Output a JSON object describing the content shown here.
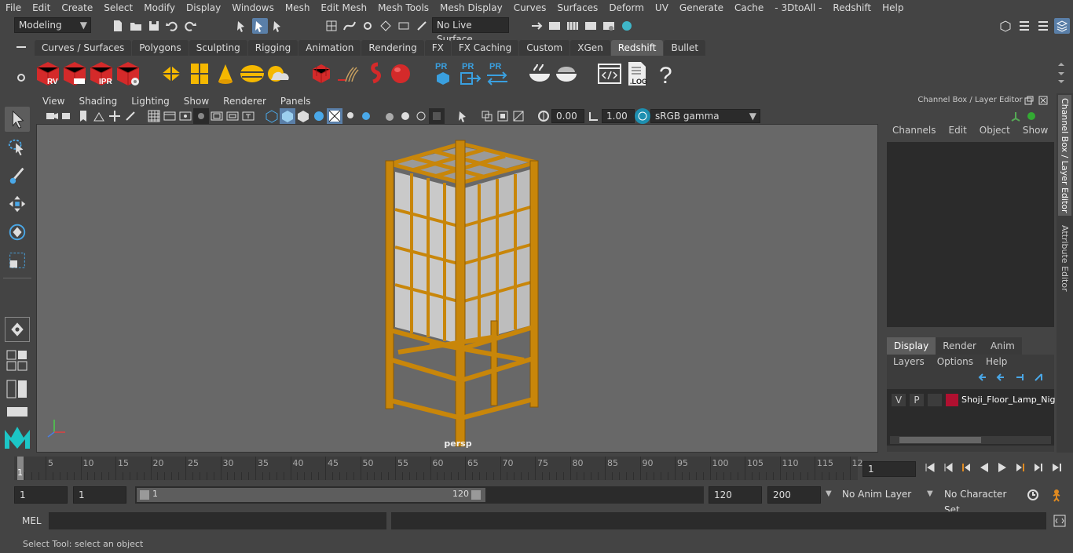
{
  "menubar": {
    "items": [
      "File",
      "Edit",
      "Create",
      "Select",
      "Modify",
      "Display",
      "Windows",
      "Mesh",
      "Edit Mesh",
      "Mesh Tools",
      "Mesh Display",
      "Curves",
      "Surfaces",
      "Deform",
      "UV",
      "Generate",
      "Cache",
      "- 3DtoAll -",
      "Redshift",
      "Help"
    ]
  },
  "status": {
    "mode": "Modeling",
    "live_surface": "No Live Surface"
  },
  "shelf_tabs": [
    {
      "label": "Curves / Surfaces"
    },
    {
      "label": "Polygons"
    },
    {
      "label": "Sculpting"
    },
    {
      "label": "Rigging"
    },
    {
      "label": "Animation"
    },
    {
      "label": "Rendering"
    },
    {
      "label": "FX"
    },
    {
      "label": "FX Caching"
    },
    {
      "label": "Custom"
    },
    {
      "label": "XGen"
    },
    {
      "label": "Redshift",
      "active": true
    },
    {
      "label": "Bullet"
    }
  ],
  "shelf_icons": {
    "rv": "RV",
    "ipr": "IPR",
    "pr": "PR",
    "log": ".LOG",
    "question": "?"
  },
  "viewport": {
    "menu": [
      "View",
      "Shading",
      "Lighting",
      "Show",
      "Renderer",
      "Panels"
    ],
    "exposure": "0.00",
    "gamma": "1.00",
    "colorspace": "sRGB gamma",
    "camera": "persp"
  },
  "channelbox": {
    "title": "Channel Box / Layer Editor",
    "menu": [
      "Channels",
      "Edit",
      "Object",
      "Show"
    ],
    "layer_tabs": [
      "Display",
      "Render",
      "Anim"
    ],
    "layer_menu": [
      "Layers",
      "Options",
      "Help"
    ],
    "layer": {
      "v": "V",
      "p": "P",
      "name": "Shoji_Floor_Lamp_Nig",
      "color": "#b01030"
    }
  },
  "side_tabs": [
    "Channel Box / Layer Editor",
    "Attribute Editor"
  ],
  "timeline": {
    "ticks": [
      "5",
      "10",
      "15",
      "20",
      "25",
      "30",
      "35",
      "40",
      "45",
      "50",
      "55",
      "60",
      "65",
      "70",
      "75",
      "80",
      "85",
      "90",
      "95",
      "100",
      "105",
      "110",
      "115",
      "12"
    ],
    "start_label": "1",
    "current_frame": "1"
  },
  "range": {
    "start": "1",
    "playback_start": "1",
    "slider_start": "1",
    "slider_end": "120",
    "playback_end": "120",
    "end": "200",
    "anim_layer": "No Anim Layer",
    "char_set": "No Character Set"
  },
  "cmd": {
    "label": "MEL"
  },
  "help": {
    "text": "Select Tool: select an object"
  },
  "colors": {
    "accent": "#5d5d5d",
    "wood": "#c8860a",
    "paper": "#c9c9c9",
    "viewport": "#686868"
  }
}
